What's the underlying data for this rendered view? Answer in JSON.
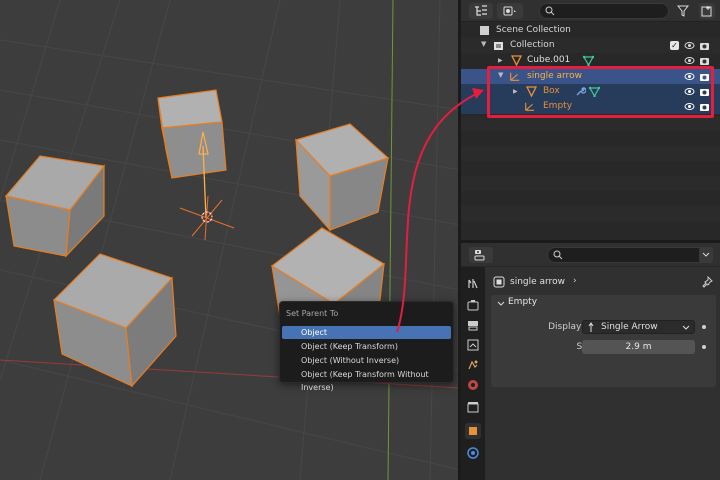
{
  "parent_menu": {
    "title": "Set Parent To",
    "items": [
      {
        "label": "Object",
        "active": true
      },
      {
        "label": "Object (Keep Transform)",
        "active": false
      },
      {
        "label": "Object (Without Inverse)",
        "active": false
      },
      {
        "label": "Object (Keep Transform Without Inverse)",
        "active": false
      }
    ]
  },
  "outliner": {
    "rows": [
      {
        "label": "Scene Collection",
        "icon": "scene-collection-icon"
      },
      {
        "label": "Collection",
        "icon": "collection-icon"
      },
      {
        "label": "Cube.001",
        "icon": "mesh-object-icon"
      },
      {
        "label": "single arrow",
        "icon": "empty-object-icon"
      },
      {
        "label": "Box",
        "icon": "mesh-object-icon"
      },
      {
        "label": "Empty",
        "icon": "empty-data-icon"
      }
    ]
  },
  "properties": {
    "object_name": "single arrow",
    "panel_title": "Empty",
    "display_as_label": "Display As",
    "display_as_value": "Single Arrow",
    "size_label": "Size",
    "size_value": "2.9 m"
  },
  "colors": {
    "selection_outline": "#e87d20",
    "active_selection": "#ffb047",
    "menu_active": "#4772b3",
    "annotation_red": "#e41e3f",
    "outliner_selected": "#3a5388"
  }
}
